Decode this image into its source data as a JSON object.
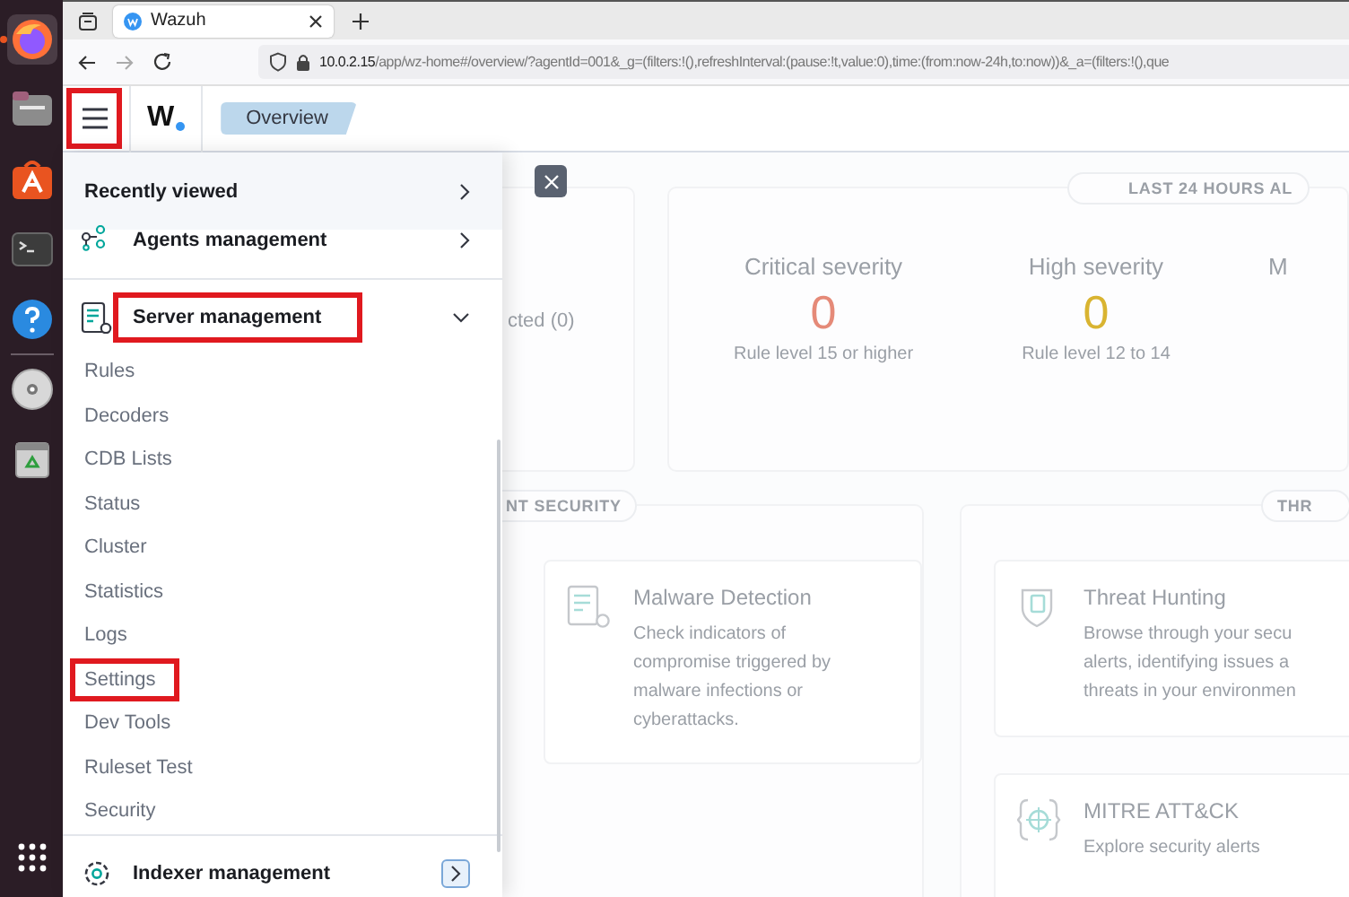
{
  "dock": {
    "items": [
      {
        "kind": "firefox",
        "active": true
      },
      {
        "kind": "files",
        "active": false
      },
      {
        "kind": "appcenter",
        "active": false
      },
      {
        "kind": "terminal",
        "active": false
      },
      {
        "kind": "help",
        "active": false
      },
      {
        "kind": "disc",
        "active": false
      },
      {
        "kind": "trash",
        "active": false
      }
    ]
  },
  "browser": {
    "tab": {
      "title": "Wazuh"
    },
    "url": {
      "host": "10.0.2.15",
      "path": "/app/wz-home#/overview/?agentId=001&_g=(filters:!(),refreshInterval:(pause:!t,value:0),time:(from:now-24h,to:now))&_a=(filters:!(),que"
    }
  },
  "header": {
    "menu_button": {
      "highlighted": true
    },
    "logo": "W",
    "breadcrumb": "Overview"
  },
  "nav_menu": {
    "recently_viewed": "Recently viewed",
    "sections": [
      {
        "kind": "agents",
        "label": "Agents management",
        "expanded": false,
        "highlighted": false,
        "focused": false
      },
      {
        "kind": "server",
        "label": "Server management",
        "expanded": true,
        "highlighted": true,
        "focused": false,
        "children": [
          {
            "label": "Rules",
            "highlighted": false
          },
          {
            "label": "Decoders",
            "highlighted": false
          },
          {
            "label": "CDB Lists",
            "highlighted": false
          },
          {
            "label": "Status",
            "highlighted": false
          },
          {
            "label": "Cluster",
            "highlighted": false
          },
          {
            "label": "Statistics",
            "highlighted": false
          },
          {
            "label": "Logs",
            "highlighted": false
          },
          {
            "label": "Settings",
            "highlighted": true
          },
          {
            "label": "Dev Tools",
            "highlighted": false
          },
          {
            "label": "Ruleset Test",
            "highlighted": false
          },
          {
            "label": "Security",
            "highlighted": false
          }
        ]
      },
      {
        "kind": "indexer",
        "label": "Indexer management",
        "expanded": false,
        "highlighted": false,
        "focused": true
      }
    ]
  },
  "dashboard": {
    "agents_card": {
      "text": "cted (0)"
    },
    "alerts": {
      "title": "LAST 24 HOURS AL",
      "stats": [
        {
          "label": "Critical severity",
          "value": "0",
          "color": "#e58a78",
          "caption": "Rule level 15 or higher"
        },
        {
          "label": "High severity",
          "value": "0",
          "color": "#d9b431",
          "caption": "Rule level 12 to 14"
        },
        {
          "label": "M"
        }
      ]
    },
    "sections": [
      {
        "title": "NT SECURITY",
        "modules": [
          {
            "kind": "malware",
            "title": "Malware Detection",
            "lines": [
              "Check indicators of",
              "compromise triggered by",
              "malware infections or",
              "cyberattacks."
            ]
          }
        ]
      },
      {
        "title": "THR",
        "modules": [
          {
            "kind": "threat",
            "title": "Threat Hunting",
            "lines": [
              "Browse through your secu",
              "alerts, identifying issues a",
              "threats in your environmen"
            ]
          },
          {
            "kind": "mitre",
            "title": "MITRE ATT&CK",
            "lines": [
              "Explore security alerts"
            ]
          }
        ]
      }
    ]
  }
}
